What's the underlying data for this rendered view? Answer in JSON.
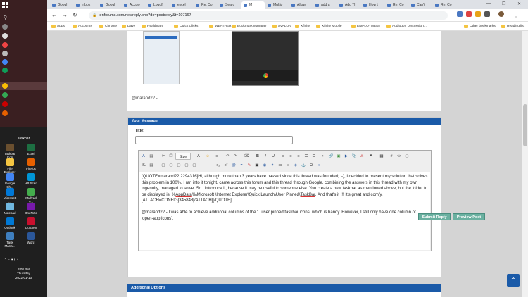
{
  "taskbar": {
    "toolbar_label": "Taskbar",
    "apps": [
      {
        "label": "Taskbar Icon",
        "color": "#6a4f2f"
      },
      {
        "label": "Excel",
        "color": "#1d6f42"
      },
      {
        "label": "File Explorer",
        "color": "#f4c542"
      },
      {
        "label": "Firefox",
        "color": "#e66000"
      },
      {
        "label": "Google Ch...",
        "color": "#4285f4"
      },
      {
        "label": "HP Scan",
        "color": "#0096d6"
      },
      {
        "label": "Microsoft ...",
        "color": "#0078d7"
      },
      {
        "label": "Mullvad V...",
        "color": "#44ad4d"
      },
      {
        "label": "Notepad",
        "color": "#70b8e0"
      },
      {
        "label": "OneNote",
        "color": "#7719aa"
      },
      {
        "label": "Outlook",
        "color": "#0078d4"
      },
      {
        "label": "Quicken",
        "color": "#c8102e"
      },
      {
        "label": "Task Mana...",
        "color": "#3f7fbf"
      },
      {
        "label": "Word",
        "color": "#2b579a"
      }
    ],
    "time": "3:08 PM",
    "day": "Thursday",
    "date": "2022-01-13"
  },
  "browser": {
    "tabs": [
      "Googl",
      "Inbox",
      "Googl",
      "Accuw",
      "Logoff",
      "excel",
      "Re: Co",
      "Searc",
      "M",
      "Multip",
      "Allow",
      "add a",
      "Add Tl",
      "How t",
      "Re: Co",
      "Can't",
      "Re: Co"
    ],
    "active_tab_index": 8,
    "url": "tenforums.com/newreply.php?do=postreply&t=107167",
    "bookmarks": [
      "Apps",
      "Accounts",
      "Chrome",
      "Dave",
      "Healthcare",
      "Quick Clicks",
      "WEATHER",
      "Bookmark Manager",
      "AVALON",
      "Xfinity",
      "Xfinity Mobile",
      "EMPLOYMENT",
      "Audiogon Discussion..."
    ],
    "other_bookmarks": "Other bookmarks",
    "reading_list": "Reading list"
  },
  "post": {
    "quote_name": "@marand22 -"
  },
  "form": {
    "header": "Your Message",
    "title_label": "Title:",
    "title_value": "",
    "size_label": "Size",
    "editor_p1_a": "[QUOTE=marand22;2294316]Hi, although more than 3 years have passed since this thread was founded; :-), I decided to present my solution that solves this problem in 100%. I ran into it tonight, came across this forum and this thread through Google, combining the answers in this thread with my own ingenuity, managed to solve. So I introduce it, because it may be useful to someone else. You create a new taskbar as mentioned above, but the folder to be displayed is: %",
    "editor_p1_appdata": "AppData",
    "editor_p1_b": "%\\Microsoft \\Internet Explorer\\Quick Launch\\User Pinned\\",
    "editor_p1_taskbar": "TaskBar",
    "editor_p1_c": ". And that's it !!! It's great and comfy. [ATTACH=CONFIG]345848[/ATTACH][/QUOTE]",
    "editor_p2": "@marand22 - I was able to achieve additional columns of the '...user pinned\\taskbar icons, which is handy. However, I still only have one column of 'open-app icons'.",
    "submit_label": "Submit Reply",
    "preview_label": "Preview Post"
  },
  "options": {
    "header": "Additional Options"
  }
}
